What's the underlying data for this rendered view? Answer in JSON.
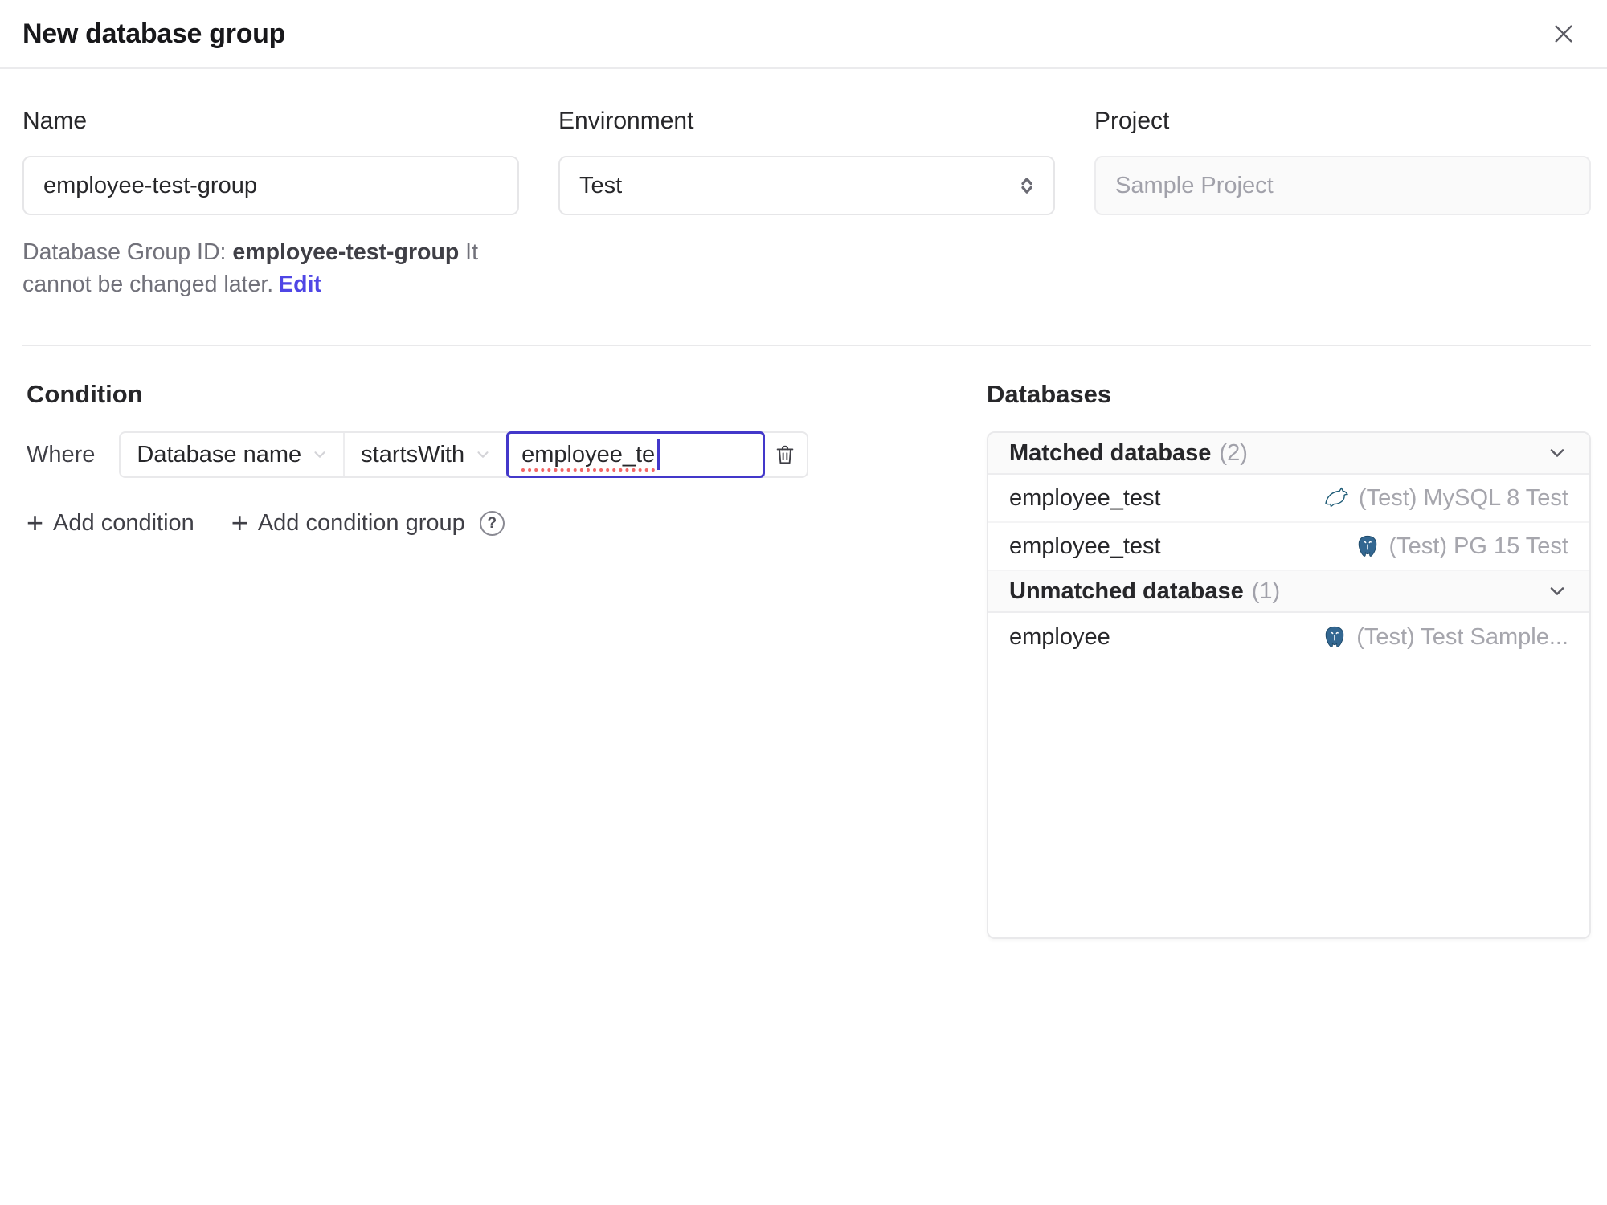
{
  "dialog": {
    "title": "New database group"
  },
  "form": {
    "name": {
      "label": "Name",
      "value": "employee-test-group"
    },
    "environment": {
      "label": "Environment",
      "value": "Test"
    },
    "project": {
      "label": "Project",
      "value": "Sample Project"
    },
    "group_id": {
      "prefix": "Database Group ID: ",
      "id": "employee-test-group",
      "suffix": " It cannot be changed later.",
      "edit_label": "Edit"
    }
  },
  "condition": {
    "heading": "Condition",
    "where_label": "Where",
    "field": "Database name",
    "operator": "startsWith",
    "value": "employee_te",
    "add_condition": "Add condition",
    "add_condition_group": "Add condition group",
    "help_glyph": "?",
    "plus_glyph": "+"
  },
  "databases": {
    "heading": "Databases",
    "sections": [
      {
        "title": "Matched database",
        "count": "(2)",
        "rows": [
          {
            "name": "employee_test",
            "engine": "mysql",
            "instance": "(Test) MySQL 8 Test"
          },
          {
            "name": "employee_test",
            "engine": "postgresql",
            "instance": "(Test) PG 15 Test"
          }
        ]
      },
      {
        "title": "Unmatched database",
        "count": "(1)",
        "rows": [
          {
            "name": "employee",
            "engine": "postgresql",
            "instance": "(Test) Test Sample..."
          }
        ]
      }
    ]
  },
  "icons": {
    "close": "x-mark",
    "select": "up-down-chevrons",
    "collapse": "chevron-down",
    "delete": "trash-can",
    "mysql": "dolphin-logo",
    "postgresql": "elephant-logo"
  },
  "colors": {
    "accent_indigo": "#4f46e5",
    "focus_border": "#4338ca",
    "spellcheck_red": "#f26767",
    "border": "#e9e9eb",
    "muted_text": "#a1a1aa",
    "dark_text": "#27272a",
    "panel_header_bg": "#fafafa"
  }
}
